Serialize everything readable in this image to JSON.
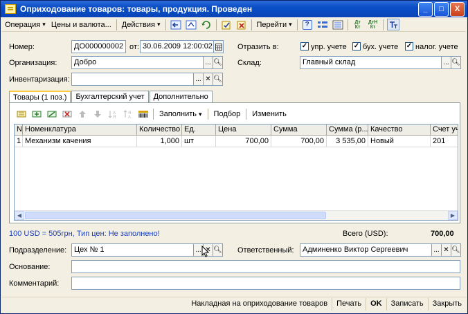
{
  "window": {
    "title": "Оприходование товаров: товары, продукция. Проведен",
    "minimize": "_",
    "maximize": "□",
    "close": "X"
  },
  "toolbar": {
    "operation": "Операция",
    "prices": "Цены и валюта...",
    "actions": "Действия",
    "goto": "Перейти",
    "help": "?",
    "dt_kt": "Дт Кт",
    "dt_kt_h": "ДтН Кт"
  },
  "header": {
    "number_label": "Номер:",
    "number_value": "ДО000000002",
    "date_label": "от:",
    "date_value": "30.06.2009 12:00:02",
    "reflect_label": "Отразить в:",
    "check_mgmt": "упр. учете",
    "check_acc": "бух. учете",
    "check_tax": "налог. учете",
    "org_label": "Организация:",
    "org_value": "Добро",
    "warehouse_label": "Склад:",
    "warehouse_value": "Главный склад",
    "inventory_label": "Инвентаризация:",
    "inventory_value": ""
  },
  "tabs": [
    {
      "label": "Товары (1 поз.)"
    },
    {
      "label": "Бухгалтерский учет"
    },
    {
      "label": "Дополнительно"
    }
  ],
  "grid_toolbar": {
    "fill": "Заполнить",
    "selection": "Подбор",
    "change": "Изменить"
  },
  "grid": {
    "columns": [
      "N",
      "Номенклатура",
      "Количество",
      "Ед.",
      "Цена",
      "Сумма",
      "Сумма (р...",
      "Качество",
      "Счет уч"
    ],
    "rows": [
      [
        "1",
        "Механизм качения",
        "1,000",
        "шт",
        "700,00",
        "700,00",
        "3 535,00",
        "Новый",
        "201"
      ]
    ]
  },
  "footer": {
    "rate_info": "100 USD = 505грн, Тип цен: Не заполнено!",
    "total_label": "Всего (USD):",
    "total_value": "700,00",
    "division_label": "Подразделение:",
    "division_value": "Цех № 1",
    "responsible_label": "Ответственный:",
    "responsible_value": "Админенко Виктор Сергеевич",
    "basis_label": "Основание:",
    "basis_value": "",
    "comment_label": "Комментарий:",
    "comment_value": ""
  },
  "bottom_buttons": {
    "invoice": "Накладная на оприходование товаров",
    "print": "Печать",
    "ok": "OK",
    "save": "Записать",
    "close": "Закрыть"
  },
  "colors": {
    "title_bar": "#0a4fc7",
    "window_bg": "#f3f0e3",
    "info_text": "#1b3fbf"
  }
}
